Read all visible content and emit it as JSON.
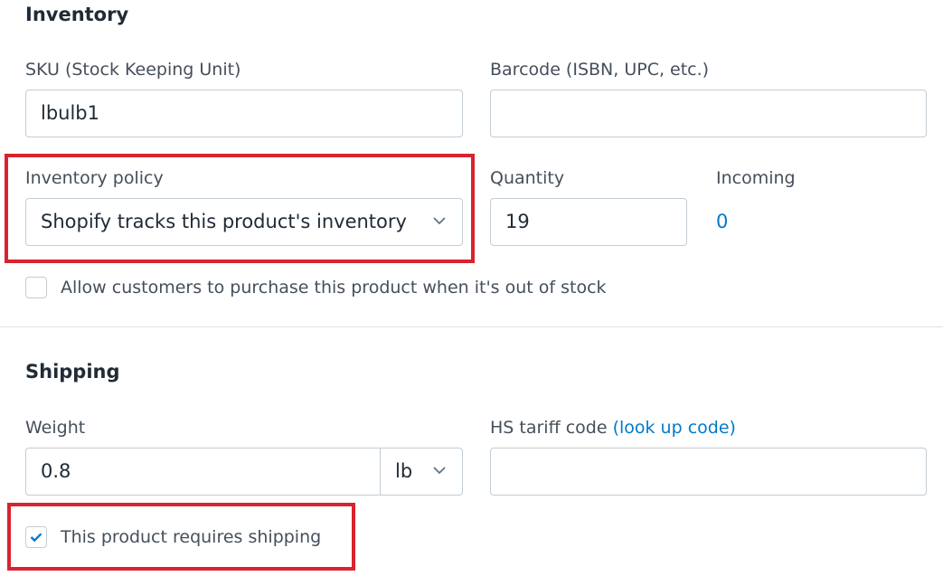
{
  "inventory": {
    "title": "Inventory",
    "sku_label": "SKU (Stock Keeping Unit)",
    "sku_value": "lbulb1",
    "barcode_label": "Barcode (ISBN, UPC, etc.)",
    "barcode_value": "",
    "policy_label": "Inventory policy",
    "policy_value": "Shopify tracks this product's inventory",
    "quantity_label": "Quantity",
    "quantity_value": "19",
    "incoming_label": "Incoming",
    "incoming_value": "0",
    "oversell_label": "Allow customers to purchase this product when it's out of stock",
    "oversell_checked": false
  },
  "shipping": {
    "title": "Shipping",
    "weight_label": "Weight",
    "weight_value": "0.8",
    "weight_unit": "lb",
    "hs_label": "HS tariff code",
    "hs_link": "(look up code)",
    "hs_value": "",
    "requires_shipping_label": "This product requires shipping",
    "requires_shipping_checked": true
  },
  "colors": {
    "highlight": "#d9232e",
    "link": "#007ace"
  }
}
